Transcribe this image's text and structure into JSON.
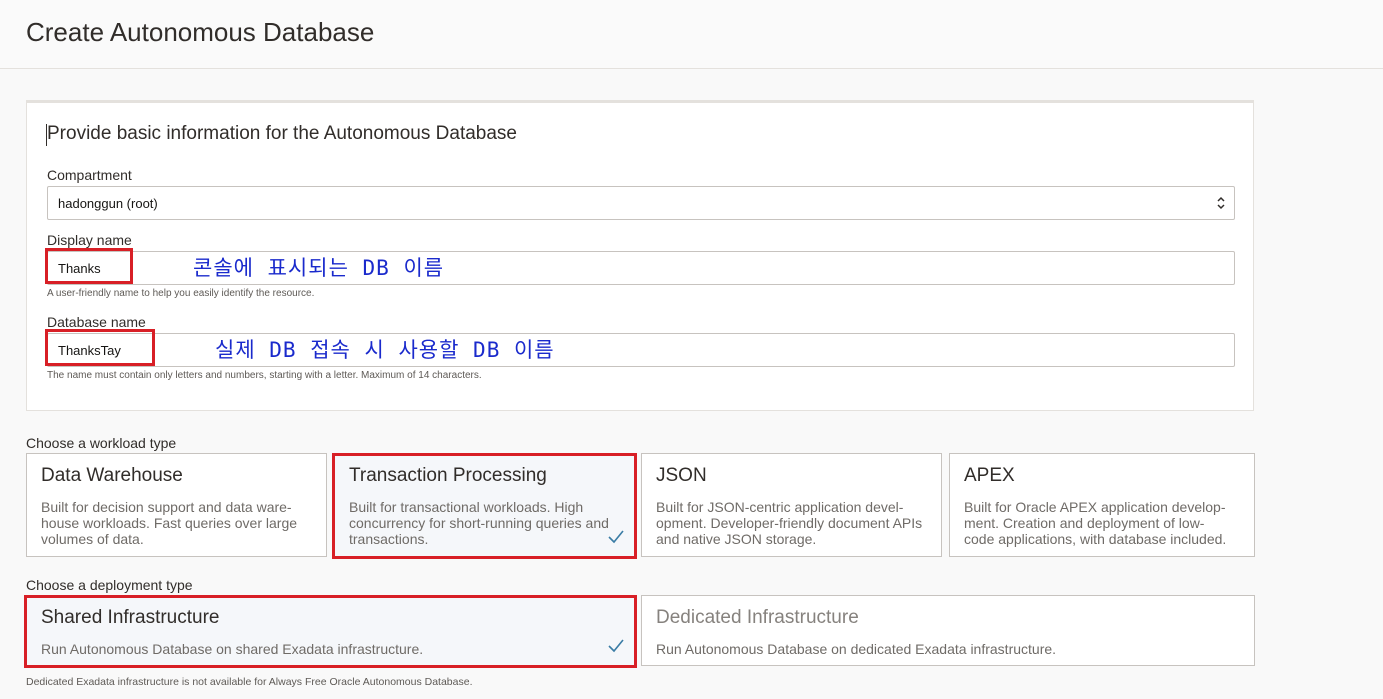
{
  "page": {
    "title": "Create Autonomous Database"
  },
  "basic_info": {
    "title": "Provide basic information for the Autonomous Database",
    "compartment": {
      "label": "Compartment",
      "value": "hadonggun (root)"
    },
    "display_name": {
      "label": "Display name",
      "value": "Thanks",
      "hint": "A user-friendly name to help you easily identify the resource.",
      "annotation": "콘솔에 표시되는 DB 이름"
    },
    "database_name": {
      "label": "Database name",
      "value": "ThanksTay",
      "hint": "The name must contain only letters and numbers, starting with a letter. Maximum of 14 characters.",
      "annotation": "실제 DB 접속 시 사용할 DB 이름"
    }
  },
  "workload": {
    "label": "Choose a workload type",
    "options": [
      {
        "title": "Data Warehouse",
        "description": "Built for decision support and data ware-house workloads. Fast queries over large volumes of data."
      },
      {
        "title": "Transaction Processing",
        "description": "Built for transactional workloads. High concurrency for short-running queries and transactions."
      },
      {
        "title": "JSON",
        "description": "Built for JSON-centric application devel-opment. Developer-friendly document APIs and native JSON storage."
      },
      {
        "title": "APEX",
        "description": "Built for Oracle APEX application develop-ment. Creation and deployment of low-code applications, with database included."
      }
    ]
  },
  "deployment": {
    "label": "Choose a deployment type",
    "options": [
      {
        "title": "Shared Infrastructure",
        "description": "Run Autonomous Database on shared Exadata infrastructure."
      },
      {
        "title": "Dedicated Infrastructure",
        "description": "Run Autonomous Database on dedicated Exadata infrastructure."
      }
    ],
    "footnote": "Dedicated Exadata infrastructure is not available for Always Free Oracle Autonomous Database."
  },
  "colors": {
    "highlight": "#d81f26",
    "annotation": "#1a2acc",
    "check": "#3a7ca5"
  },
  "icons": {
    "select": "chevron-up-down-icon",
    "selected": "checkmark-icon"
  }
}
